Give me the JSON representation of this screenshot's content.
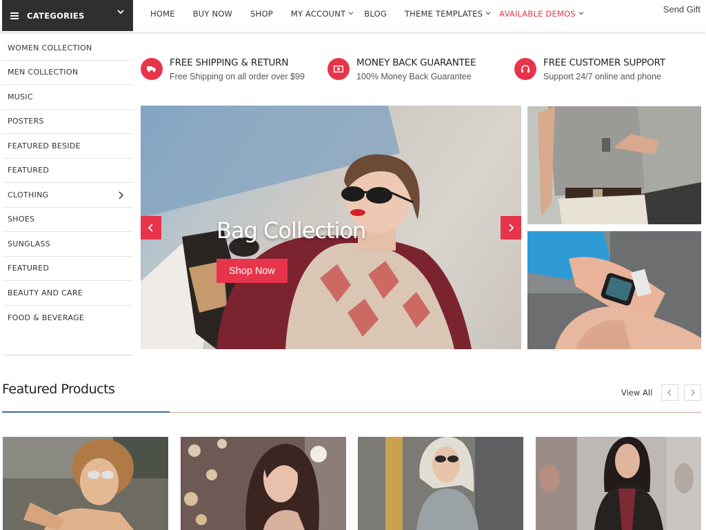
{
  "header": {
    "categories_label": "CATEGORIES",
    "nav": [
      {
        "label": "HOME"
      },
      {
        "label": "BUY NOW"
      },
      {
        "label": "SHOP"
      },
      {
        "label": "MY ACCOUNT"
      },
      {
        "label": "BLOG"
      },
      {
        "label": "THEME TEMPLATES"
      },
      {
        "label": "AVAILABLE DEMOS"
      }
    ],
    "send_gift": "Send Gift"
  },
  "sidebar": {
    "items": [
      {
        "label": "WOMEN COLLECTION"
      },
      {
        "label": "MEN COLLECTION"
      },
      {
        "label": "MUSIC"
      },
      {
        "label": "POSTERS"
      },
      {
        "label": "FEATURED BESIDE"
      },
      {
        "label": "FEATURED"
      },
      {
        "label": "CLOTHING"
      },
      {
        "label": "SHOES"
      },
      {
        "label": "SUNGLASS"
      },
      {
        "label": "FEATURED"
      },
      {
        "label": "BEAUTY AND CARE"
      },
      {
        "label": "FOOD & BEVERAGE"
      }
    ]
  },
  "features": [
    {
      "title": "FREE SHIPPING & RETURN",
      "subtitle": "Free Shipping on all order over $99",
      "icon": "truck-icon"
    },
    {
      "title": "MONEY BACK GUARANTEE",
      "subtitle": "100% Money Back Guarantee",
      "icon": "money-icon"
    },
    {
      "title": "FREE CUSTOMER SUPPORT",
      "subtitle": "Support 24/7 online and phone",
      "icon": "headset-icon"
    }
  ],
  "slider": {
    "title": "Bag Collection",
    "button_label": "Shop Now"
  },
  "featured_products": {
    "title": "Featured Products",
    "view_all": "View All"
  },
  "colors": {
    "accent": "#e7344a",
    "dark": "#2f2f2f",
    "underline": "#3f6d9e"
  }
}
